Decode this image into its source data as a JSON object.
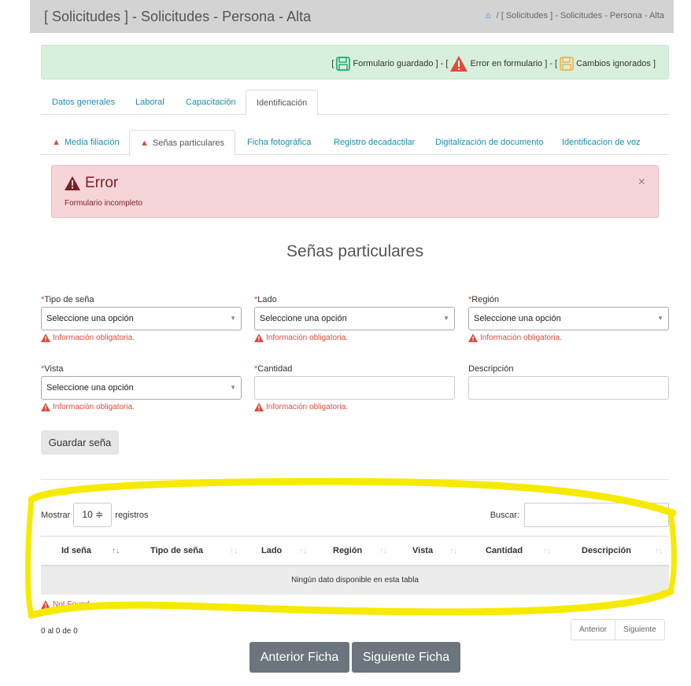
{
  "header": {
    "title": "[ Solicitudes ] - Solicitudes - Persona - Alta",
    "breadcrumb_sep": "/",
    "breadcrumb": "[ Solicitudes ] - Solicitudes - Persona - Alta"
  },
  "legend": {
    "open1": "[",
    "saved": "Formulario guardado ] - [",
    "error": "Error en formulario ] - [",
    "ignored": "Cambios ignorados ]"
  },
  "main_tabs": [
    "Datos generales",
    "Laboral",
    "Capacitación",
    "Identificación"
  ],
  "sub_tabs": [
    "Media filiación",
    "Señas particulares",
    "Ficha fotográfica",
    "Registro decadactilar",
    "Digitalización de documento",
    "Identificacion de voz"
  ],
  "alert": {
    "title": "Error",
    "message": "Formulario incompleto",
    "close": "×"
  },
  "section_title": "Señas particulares",
  "form": {
    "required_mark": "*",
    "tipo": {
      "label": "Tipo de seña",
      "value": "Seleccione una opción",
      "error": "Información obligatoria."
    },
    "lado": {
      "label": "Lado",
      "value": "Seleccione una opción",
      "error": "Información obligatoria."
    },
    "region": {
      "label": "Región",
      "value": "Seleccione una opción",
      "error": "Información obligatoria."
    },
    "vista": {
      "label": "Vista",
      "value": "Seleccione una opción",
      "error": "Información obligatoria."
    },
    "cantidad": {
      "label": "Cantidad",
      "value": "",
      "error": "Información obligatoria."
    },
    "descripcion": {
      "label": "Descripción",
      "value": ""
    },
    "save_label": "Guardar seña"
  },
  "table": {
    "show_label": "Mostrar",
    "page_size": "10 ≑",
    "records_label": "registros",
    "search_label": "Buscar:",
    "columns": [
      "Id seña",
      "Tipo de seña",
      "Lado",
      "Región",
      "Vista",
      "Cantidad",
      "Descripción"
    ],
    "empty_message": "Ningún dato disponible en esta tabla",
    "not_found": "Not Found",
    "info": "0 al 0 de 0",
    "prev": "Anterior",
    "next": "Siguiente"
  },
  "nav": {
    "prev_sheet": "Anterior Ficha",
    "next_sheet": "Siguiente Ficha"
  },
  "colors": {
    "accent": "#1a8fb0",
    "error": "#e24a3b",
    "success_bg": "#d7f0dc",
    "alert_bg": "#f6d5d8",
    "highlight": "#f5ea00"
  }
}
